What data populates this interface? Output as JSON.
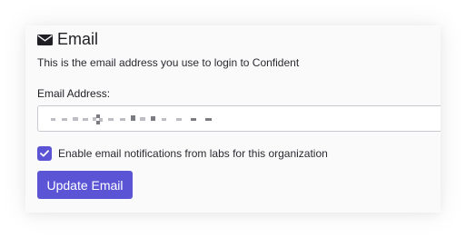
{
  "section": {
    "icon": "envelope-icon",
    "title": "Email",
    "description": "This is the email address you use to login to Confident"
  },
  "email_field": {
    "label": "Email Address:",
    "value": "",
    "obscured": true
  },
  "notifications": {
    "checked": true,
    "label": "Enable email notifications from labs for this organization"
  },
  "actions": {
    "update_label": "Update Email"
  },
  "colors": {
    "accent": "#5b55d6",
    "card_background": "#fafafb",
    "text": "#1f1f24"
  }
}
